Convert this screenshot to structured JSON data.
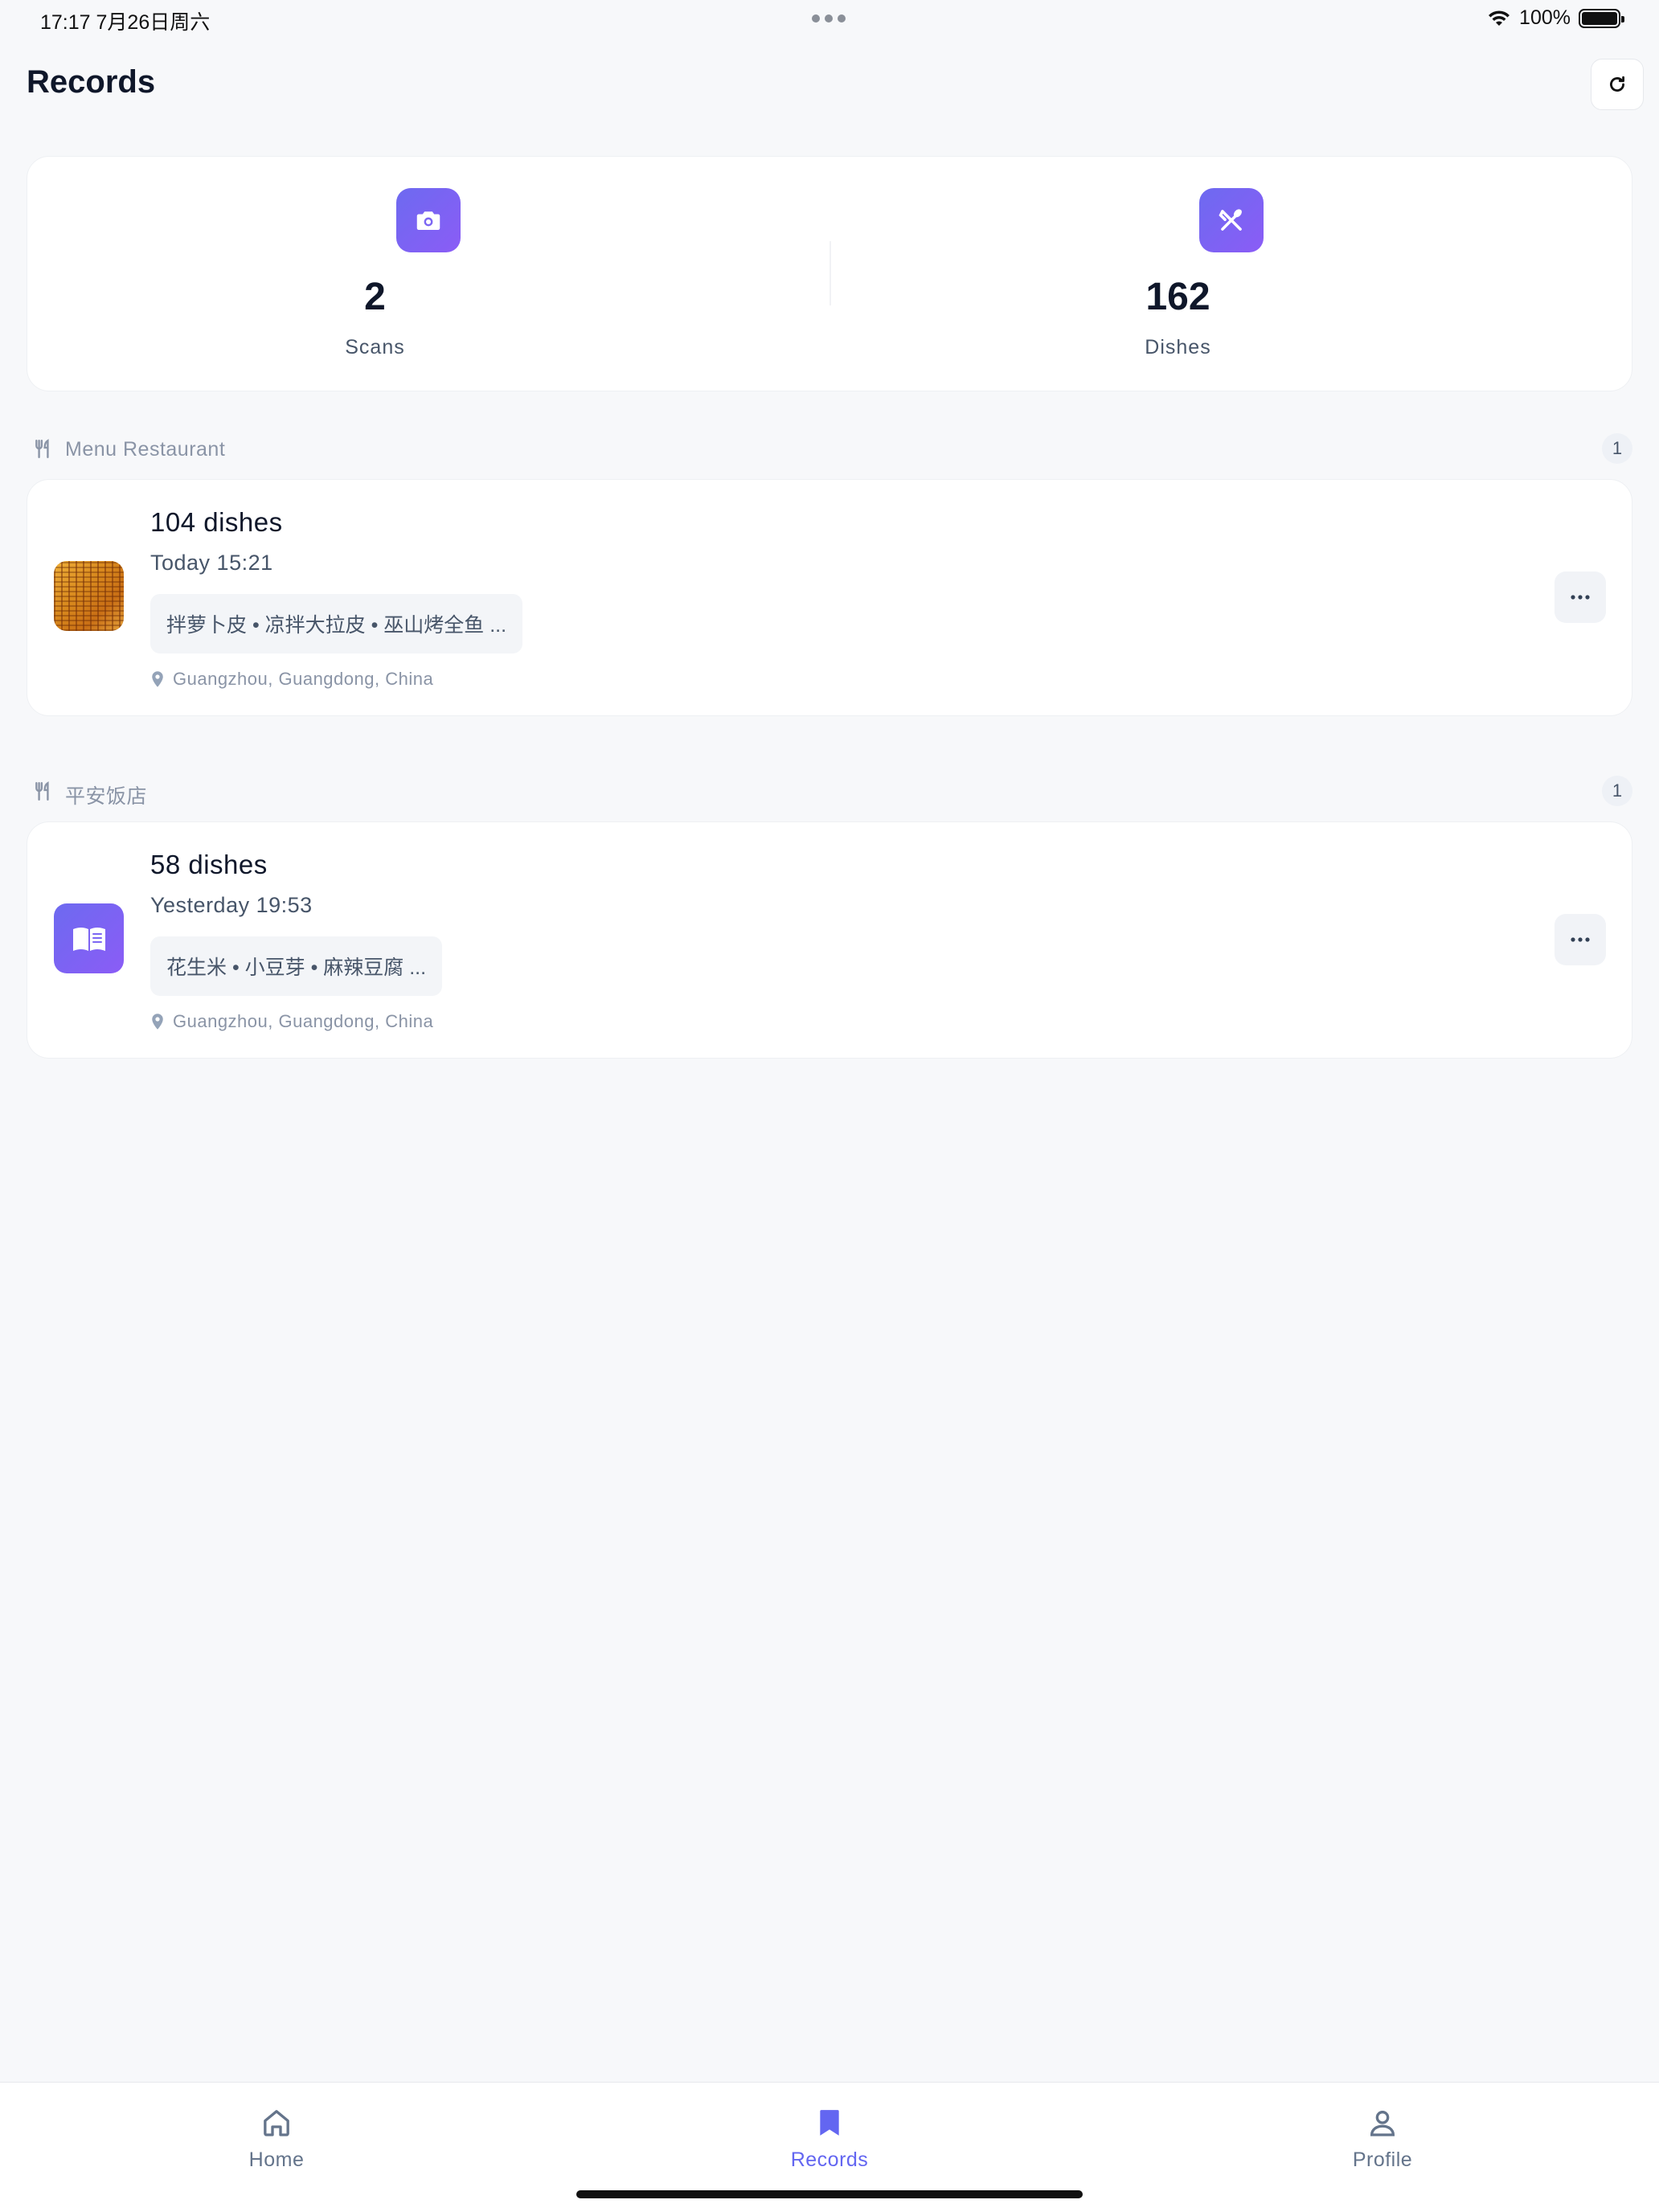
{
  "status_bar": {
    "time": "17:17   7月26日周六",
    "battery_text": "100%",
    "battery_level": 1.0
  },
  "header": {
    "title": "Records",
    "refresh_icon": "refresh-icon"
  },
  "stats": {
    "scans": {
      "value": "2",
      "label": "Scans",
      "icon": "camera-icon"
    },
    "dishes": {
      "value": "162",
      "label": "Dishes",
      "icon": "utensils-icon"
    }
  },
  "sections": [
    {
      "title": "Menu Restaurant",
      "count": "1",
      "record": {
        "title": "104 dishes",
        "time": "Today 15:21",
        "dishes": "拌萝卜皮 • 凉拌大拉皮 • 巫山烤全鱼 ...",
        "location": "Guangzhou, Guangdong, China",
        "thumb": "menu-photo"
      }
    },
    {
      "title": "平安饭店",
      "count": "1",
      "record": {
        "title": "58 dishes",
        "time": "Yesterday 19:53",
        "dishes": "花生米 • 小豆芽 • 麻辣豆腐 ...",
        "location": "Guangzhou, Guangdong, China",
        "thumb": "book-icon"
      }
    }
  ],
  "tabs": [
    {
      "label": "Home",
      "icon": "home-icon",
      "active": false
    },
    {
      "label": "Records",
      "icon": "bookmark-icon",
      "active": true
    },
    {
      "label": "Profile",
      "icon": "user-icon",
      "active": false
    }
  ],
  "colors": {
    "accent": "#6366f1",
    "gradient_start": "#6d6af0",
    "gradient_end": "#8b5cf6",
    "background": "#f7f8fa"
  }
}
